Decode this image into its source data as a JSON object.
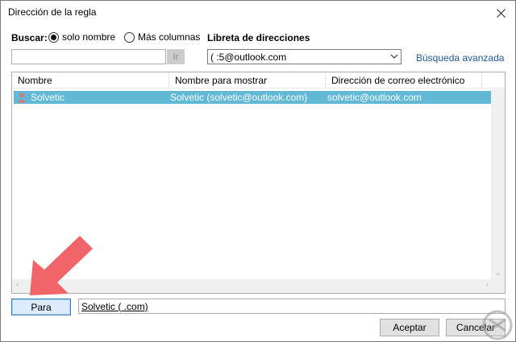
{
  "window": {
    "title": "Dirección de la regla",
    "close_glyph": "✕"
  },
  "search": {
    "label": "Buscar:",
    "option_name": "solo nombre",
    "option_more": "Más columnas",
    "selected": "solo nombre",
    "input_value": "",
    "go_label": "Ir"
  },
  "address_book": {
    "label": "Libreta de direcciones",
    "selected_value": "(                              :5@outlook.com",
    "advanced_link": "Búsqueda avanzada"
  },
  "list": {
    "columns": [
      "Nombre",
      "Nombre para mostrar",
      "Dirección de correo electrónico"
    ],
    "rows": [
      {
        "name": "Solvetic",
        "display": "Solvetic (solvetic@outlook.com)",
        "email": "solvetic@outlook.com",
        "selected": true,
        "icon": "contact-person-icon"
      }
    ]
  },
  "recipient": {
    "button_label": "Para",
    "value": "Solvetic (                              .com)"
  },
  "footer": {
    "ok_label": "Aceptar",
    "cancel_label": "Cancelar"
  },
  "colors": {
    "selection": "#61b9d6",
    "link": "#1e5aa0",
    "overlay_arrow": "#f0646a"
  }
}
